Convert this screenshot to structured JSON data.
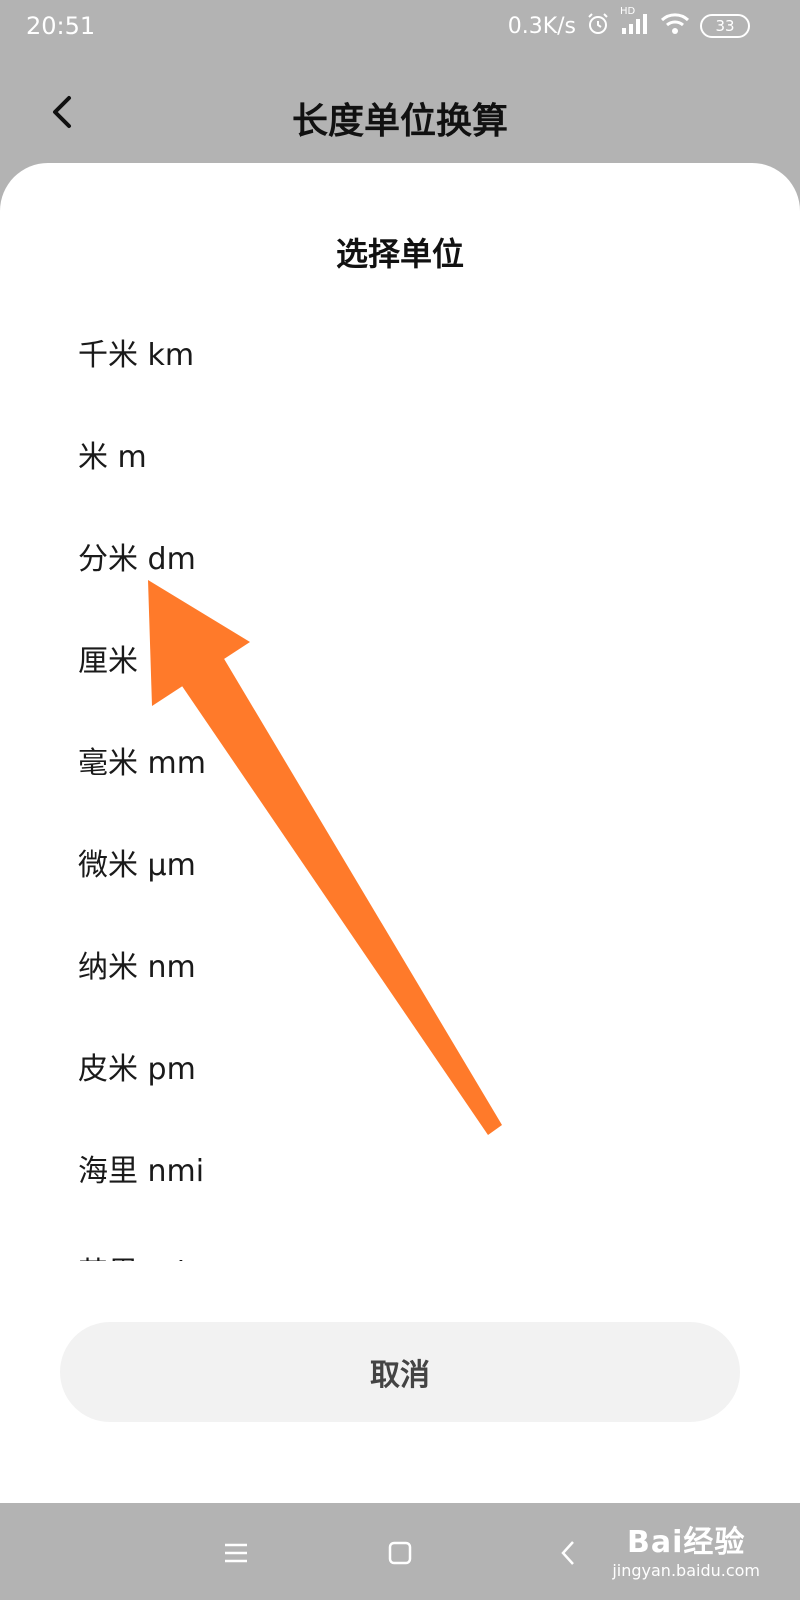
{
  "status_bar": {
    "time": "20:51",
    "net_speed": "0.3K/s",
    "hd_label": "HD",
    "battery": "33"
  },
  "header": {
    "title": "长度单位换算"
  },
  "sheet": {
    "title": "选择单位",
    "items": [
      {
        "label": "千米 km"
      },
      {
        "label": "米 m"
      },
      {
        "label": "分米 dm"
      },
      {
        "label": "厘米"
      },
      {
        "label": "毫米 mm"
      },
      {
        "label": "微米 μm"
      },
      {
        "label": "纳米 nm"
      },
      {
        "label": "皮米 pm"
      },
      {
        "label": "海里 nmi"
      },
      {
        "label": "英里 mi"
      }
    ],
    "cancel_label": "取消"
  },
  "watermark": {
    "brand": "Bai经验",
    "url": "jingyan.baidu.com"
  },
  "colors": {
    "backdrop": "#b3b3b3",
    "sheet": "#ffffff",
    "arrow": "#ff7a2a",
    "cancel_bg": "#f2f2f2"
  }
}
